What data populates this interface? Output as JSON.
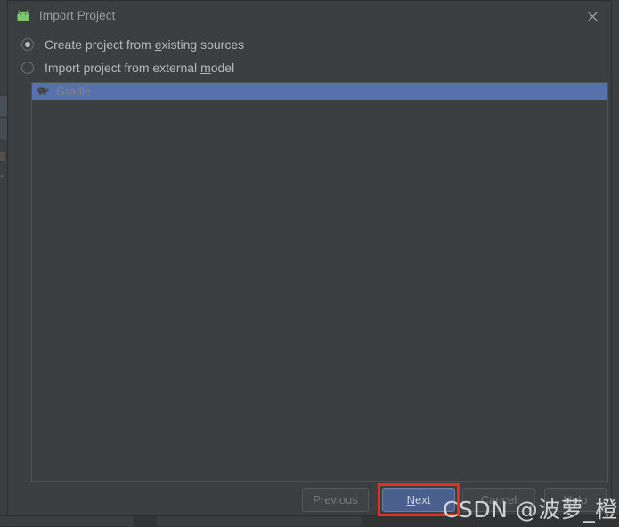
{
  "window": {
    "title": "Import Project",
    "app_icon": "android-icon",
    "close_icon": "close-icon",
    "background": "#3c3f41",
    "accent_selection": "#5771ac",
    "highlight_annotation_color": "#e03122",
    "android_icon_color": "#7cc66e"
  },
  "options": [
    {
      "id": "create-from-existing-sources",
      "label_before": "Create project from ",
      "mnemonic": "e",
      "label_after": "xisting sources",
      "checked": true
    },
    {
      "id": "import-from-external-model",
      "label_before": "Import project from external ",
      "mnemonic": "m",
      "label_after": "odel",
      "checked": false
    }
  ],
  "model_list": {
    "items": [
      {
        "label": "Gradle",
        "icon": "gradle-elephant-icon",
        "selected": true
      }
    ]
  },
  "buttons": {
    "previous": {
      "label": "Previous",
      "enabled": false
    },
    "next": {
      "label_before": "",
      "mnemonic": "N",
      "label_after": "ext",
      "label": "Next",
      "enabled": true,
      "default": true,
      "annotated": true
    },
    "cancel": {
      "label": "Cancel",
      "enabled": true
    },
    "help": {
      "label": "Help",
      "enabled": true
    }
  },
  "watermark": {
    "text": "CSDN @波萝_橙留香"
  }
}
